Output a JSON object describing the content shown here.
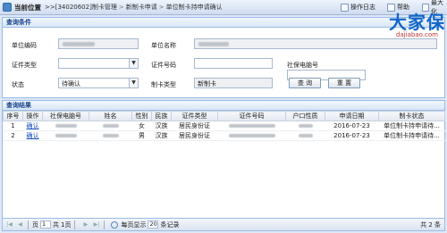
{
  "topbar": {
    "location_label": "当前位置",
    "crumbs": [
      ">>[34020602]",
      "制卡管理",
      "新制卡申请",
      "单位制卡持申请确认"
    ],
    "log_label": "操作日志",
    "help_label": "帮助",
    "max_label": "最大化"
  },
  "brand": {
    "main": "大家保",
    "sub": "dajiabao.com"
  },
  "conditions": {
    "title": "查询条件",
    "unit_code_label": "单位编码",
    "unit_name_label": "单位名称",
    "id_type_label": "证件类型",
    "id_no_label": "证件号码",
    "card_no_label": "社保电脑号",
    "status_label": "状态",
    "status_value": "待确认",
    "card_type_label": "制卡类型",
    "card_type_value": "新制卡",
    "query_btn": "查 询",
    "reset_btn": "重 置"
  },
  "results": {
    "title": "查询结果",
    "columns": [
      "序号",
      "操作",
      "社保电脑号",
      "姓名",
      "性别",
      "民族",
      "证件类型",
      "证件号码",
      "户口性质",
      "申请日期",
      "制卡状态"
    ],
    "rows": [
      {
        "no": "1",
        "op": "确认",
        "gender": "女",
        "ethnic": "汉族",
        "idtype": "居民身份证",
        "date": "2016-07-23",
        "state": "单位制卡持申请待..."
      },
      {
        "no": "2",
        "op": "确认",
        "gender": "男",
        "ethnic": "汉族",
        "idtype": "居民身份证",
        "date": "2016-07-23",
        "state": "单位制卡持申请待..."
      }
    ]
  },
  "pager": {
    "page_prefix": "页",
    "page_value": "1",
    "total_prefix": "共",
    "total_pages": "1页",
    "per_page_label": "每页显示",
    "per_page_value": "20",
    "per_page_suffix": "条记录",
    "total_records": "共 2 条"
  }
}
